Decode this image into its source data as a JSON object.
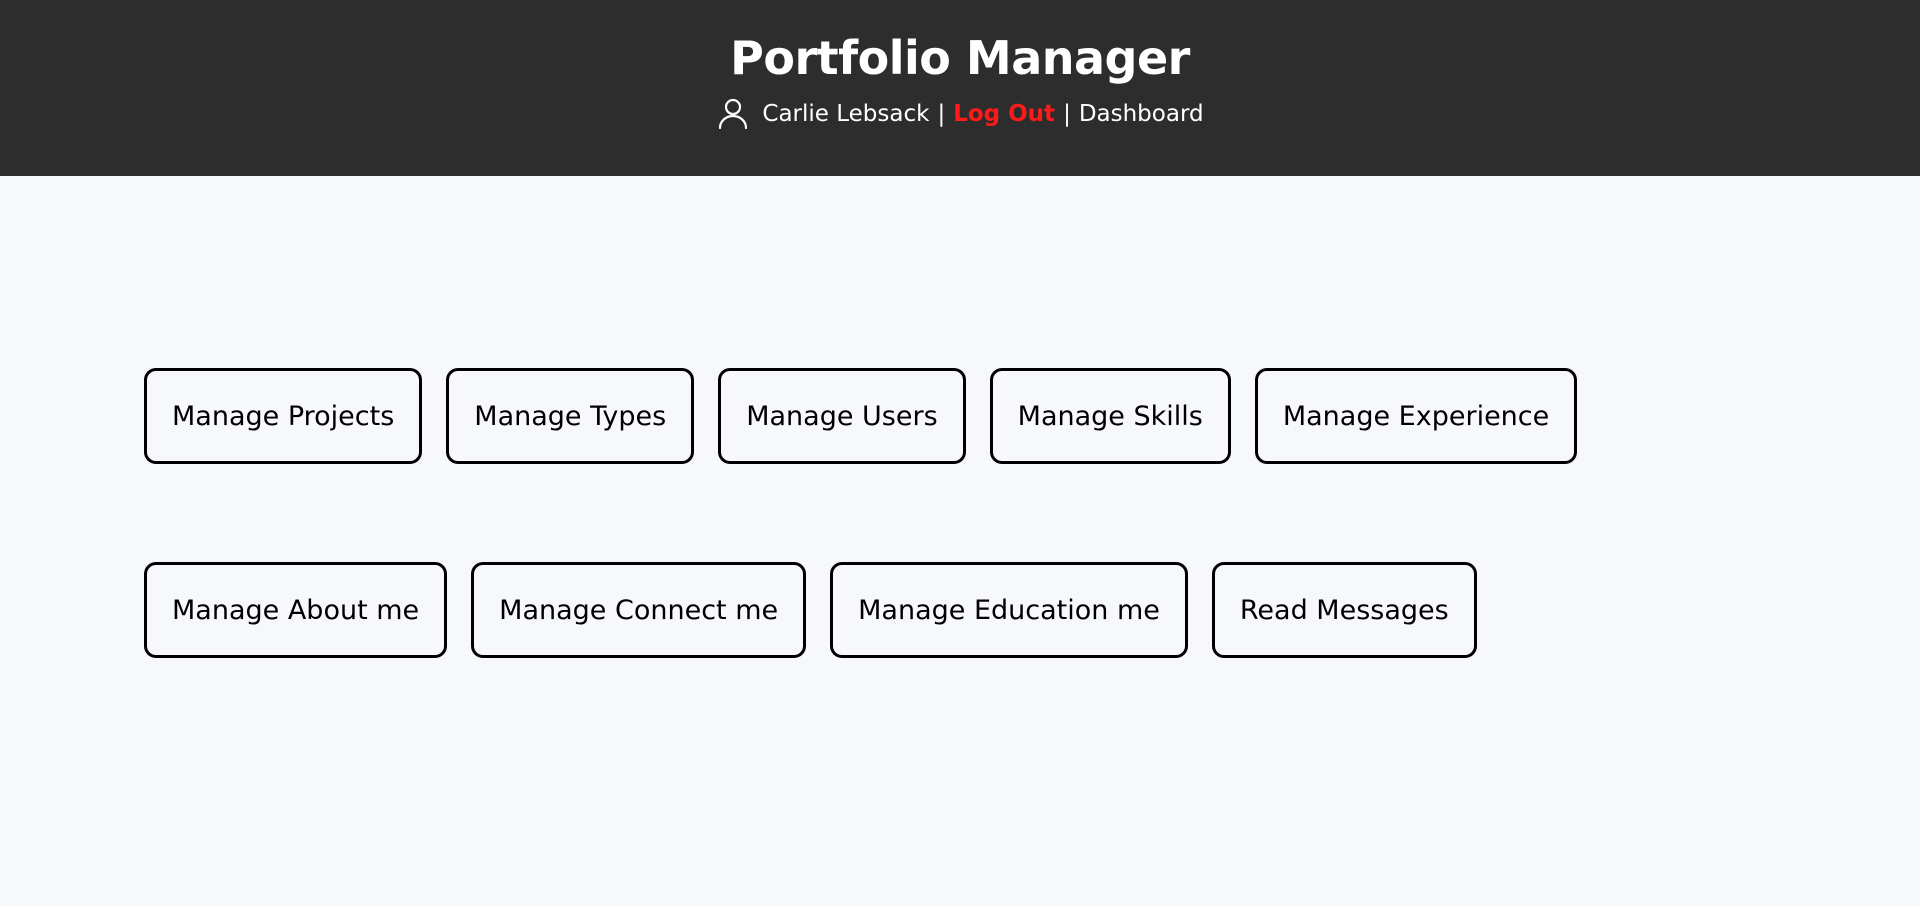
{
  "header": {
    "title": "Portfolio Manager",
    "user_icon": "user-icon",
    "user_name": "Carlie Lebsack",
    "separator": "|",
    "logout_label": "Log Out",
    "dashboard_label": "Dashboard",
    "colors": {
      "background": "#2d2d2d",
      "text": "#ffffff",
      "logout": "#ff1a1a"
    }
  },
  "main": {
    "rows": [
      {
        "buttons": [
          "Manage Projects",
          "Manage Types",
          "Manage Users",
          "Manage Skills",
          "Manage Experience"
        ]
      },
      {
        "buttons": [
          "Manage About me",
          "Manage Connect me",
          "Manage Education me",
          "Read Messages"
        ]
      }
    ],
    "colors": {
      "background": "#f7f8fc",
      "button_border": "#000000"
    }
  }
}
